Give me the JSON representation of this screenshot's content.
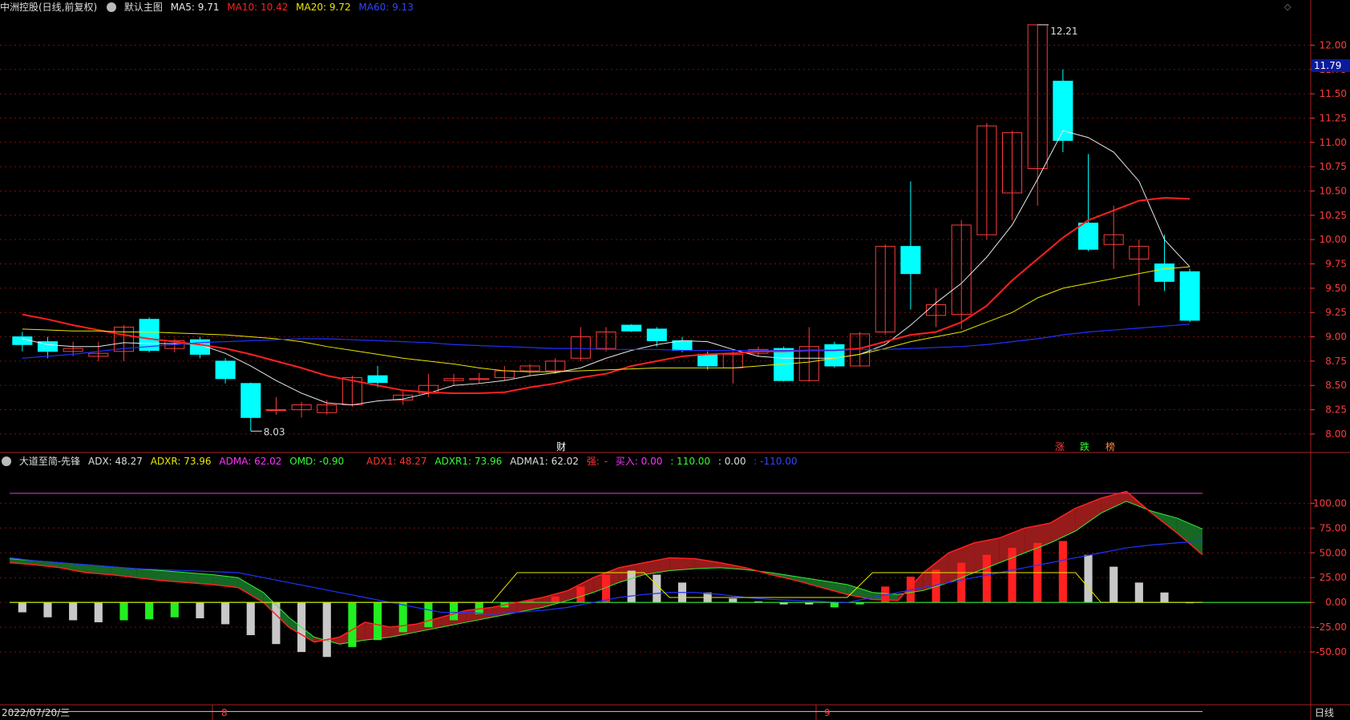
{
  "colors": {
    "background": "#000000",
    "up": "#ff3c3c",
    "down": "#00ffff",
    "ma5": "#e8e8e8",
    "ma10": "#ff2020",
    "ma20": "#e8e800",
    "ma60": "#2030ff",
    "grid": "#7a1010",
    "axis_text": "#ff3c3c",
    "purple": "#cc33cc",
    "green_band": "#1a7a2a",
    "red_band": "#b02020"
  },
  "main_header": {
    "stock": "中洲控股(日线,前复权)",
    "template": "默认主图",
    "ma5": "MA5: 9.71",
    "ma10": "MA10: 10.42",
    "ma20": "MA20: 9.72",
    "ma60": "MA60: 9.13"
  },
  "sub_header": {
    "name": "大道至简-先锋",
    "adx": "ADX: 48.27",
    "adxr": "ADXR: 73.96",
    "adma": "ADMA: 62.02",
    "omd": "OMD: -0.90",
    "adx1": "ADX1: 48.27",
    "adxr1": "ADXR1: 73.96",
    "adma1": "ADMA1: 62.02",
    "strong_label": "强:",
    "strong_val": "-",
    "buy": "买入: 0.00",
    "v110": ": 110.00",
    "v0": ": 0.00",
    "vneg110": ": -110.00"
  },
  "annotations": {
    "high": "12.21",
    "low": "8.03",
    "last_price": "11.79",
    "cai": "财",
    "zhang": "涨",
    "die": "跌",
    "bang": "榜"
  },
  "bottom_bar": {
    "start_date": "2022/07/20/三",
    "m8": "8",
    "m9": "9",
    "period": "日线"
  },
  "chart_data": [
    {
      "type": "candlestick",
      "title": "中洲控股(日线,前复权)",
      "ylim": [
        7.95,
        12.3
      ],
      "yticks": [
        8.0,
        8.25,
        8.5,
        8.75,
        9.0,
        9.25,
        9.5,
        9.75,
        10.0,
        10.25,
        10.5,
        10.75,
        11.0,
        11.25,
        11.5,
        11.75,
        12.0
      ],
      "candles": [
        [
          9.0,
          8.92,
          9.05,
          8.85
        ],
        [
          8.95,
          8.85,
          9.0,
          8.78
        ],
        [
          8.85,
          8.88,
          8.95,
          8.8
        ],
        [
          8.8,
          8.83,
          8.95,
          8.75
        ],
        [
          8.85,
          9.1,
          9.12,
          8.75
        ],
        [
          9.18,
          8.86,
          9.2,
          8.84
        ],
        [
          8.88,
          8.96,
          8.98,
          8.84
        ],
        [
          8.97,
          8.82,
          9.0,
          8.78
        ],
        [
          8.75,
          8.57,
          8.78,
          8.52
        ],
        [
          8.52,
          8.17,
          8.53,
          8.03
        ],
        [
          8.25,
          8.25,
          8.38,
          8.2
        ],
        [
          8.25,
          8.3,
          8.33,
          8.17
        ],
        [
          8.22,
          8.3,
          8.35,
          8.2
        ],
        [
          8.3,
          8.58,
          8.6,
          8.28
        ],
        [
          8.6,
          8.53,
          8.7,
          8.48
        ],
        [
          8.35,
          8.4,
          8.45,
          8.3
        ],
        [
          8.42,
          8.5,
          8.62,
          8.38
        ],
        [
          8.55,
          8.57,
          8.62,
          8.5
        ],
        [
          8.56,
          8.57,
          8.63,
          8.52
        ],
        [
          8.58,
          8.65,
          8.7,
          8.55
        ],
        [
          8.65,
          8.7,
          8.72,
          8.6
        ],
        [
          8.65,
          8.75,
          8.78,
          8.62
        ],
        [
          8.78,
          9.0,
          9.1,
          8.75
        ],
        [
          8.88,
          9.05,
          9.1,
          8.85
        ],
        [
          9.12,
          9.06,
          9.13,
          9.05
        ],
        [
          9.08,
          8.96,
          9.1,
          8.9
        ],
        [
          8.96,
          8.86,
          9.0,
          8.84
        ],
        [
          8.82,
          8.7,
          8.85,
          8.66
        ],
        [
          8.68,
          8.82,
          8.85,
          8.52
        ],
        [
          8.83,
          8.87,
          8.9,
          8.8
        ],
        [
          8.88,
          8.55,
          8.9,
          8.54
        ],
        [
          8.55,
          8.9,
          9.1,
          8.54
        ],
        [
          8.92,
          8.7,
          8.95,
          8.68
        ],
        [
          8.7,
          9.03,
          9.05,
          8.7
        ],
        [
          9.05,
          9.93,
          9.95,
          9.02
        ],
        [
          9.93,
          9.65,
          10.6,
          9.28
        ],
        [
          9.22,
          9.33,
          9.5,
          9.1
        ],
        [
          9.23,
          10.15,
          10.2,
          9.08
        ],
        [
          10.05,
          11.17,
          11.2,
          10.0
        ],
        [
          10.48,
          11.1,
          11.12,
          10.2
        ],
        [
          10.73,
          12.21,
          12.21,
          10.35
        ],
        [
          11.63,
          11.02,
          11.75,
          10.9
        ],
        [
          10.17,
          9.9,
          10.88,
          9.88
        ],
        [
          9.95,
          10.05,
          10.35,
          9.7
        ],
        [
          9.8,
          9.93,
          10.0,
          9.32
        ],
        [
          9.75,
          9.57,
          10.05,
          9.47
        ],
        [
          9.67,
          9.17,
          9.7,
          9.15
        ]
      ],
      "series": [
        {
          "name": "MA5",
          "values": [
            8.98,
            8.92,
            8.9,
            8.9,
            8.94,
            8.93,
            8.93,
            8.92,
            8.83,
            8.7,
            8.55,
            8.42,
            8.32,
            8.3,
            8.34,
            8.36,
            8.42,
            8.5,
            8.52,
            8.55,
            8.6,
            8.63,
            8.68,
            8.78,
            8.86,
            8.92,
            8.96,
            8.95,
            8.87,
            8.8,
            8.78,
            8.78,
            8.78,
            8.82,
            8.92,
            9.12,
            9.35,
            9.55,
            9.82,
            10.15,
            10.62,
            11.12,
            11.05,
            10.9,
            10.6,
            10.0,
            9.72
          ]
        },
        {
          "name": "MA10",
          "values": [
            9.23,
            9.18,
            9.12,
            9.07,
            9.02,
            8.98,
            8.95,
            8.92,
            8.88,
            8.82,
            8.75,
            8.68,
            8.6,
            8.55,
            8.5,
            8.45,
            8.43,
            8.42,
            8.42,
            8.43,
            8.48,
            8.52,
            8.58,
            8.62,
            8.7,
            8.75,
            8.8,
            8.82,
            8.83,
            8.85,
            8.85,
            8.86,
            8.86,
            8.88,
            8.95,
            9.02,
            9.05,
            9.15,
            9.32,
            9.58,
            9.8,
            10.02,
            10.2,
            10.3,
            10.4,
            10.43,
            10.42
          ]
        },
        {
          "name": "MA20",
          "values": [
            9.08,
            9.07,
            9.06,
            9.06,
            9.05,
            9.05,
            9.04,
            9.03,
            9.02,
            9.0,
            8.98,
            8.95,
            8.9,
            8.86,
            8.82,
            8.78,
            8.75,
            8.72,
            8.68,
            8.65,
            8.64,
            8.64,
            8.65,
            8.66,
            8.67,
            8.68,
            8.68,
            8.68,
            8.68,
            8.7,
            8.72,
            8.74,
            8.78,
            8.82,
            8.88,
            8.95,
            9.0,
            9.05,
            9.15,
            9.25,
            9.4,
            9.5,
            9.55,
            9.6,
            9.65,
            9.7,
            9.72
          ]
        },
        {
          "name": "MA60",
          "values": [
            8.78,
            8.8,
            8.82,
            8.85,
            8.88,
            8.9,
            8.92,
            8.94,
            8.95,
            8.96,
            8.97,
            8.98,
            8.98,
            8.97,
            8.96,
            8.95,
            8.94,
            8.92,
            8.91,
            8.9,
            8.89,
            8.88,
            8.88,
            8.87,
            8.87,
            8.87,
            8.86,
            8.86,
            8.86,
            8.86,
            8.86,
            8.86,
            8.86,
            8.87,
            8.87,
            8.88,
            8.89,
            8.9,
            8.92,
            8.95,
            8.98,
            9.02,
            9.05,
            9.07,
            9.09,
            9.11,
            9.13
          ]
        }
      ]
    },
    {
      "type": "indicator",
      "title": "大道至简-先锋",
      "ylim": [
        -100,
        135
      ],
      "yticks": [
        100.0,
        75.0,
        50.0,
        25.0,
        0.0,
        -25.0,
        -50.0
      ],
      "hlines": [
        110,
        0,
        -110
      ],
      "bars": [
        -10,
        -15,
        -18,
        -20,
        -18,
        -17,
        -15,
        -16,
        -22,
        -33,
        -42,
        -50,
        -55,
        -45,
        -38,
        -30,
        -25,
        -18,
        -12,
        -5,
        2,
        6,
        16,
        28,
        32,
        28,
        20,
        10,
        4,
        1,
        -2,
        -2,
        -5,
        -2,
        16,
        26,
        33,
        40,
        48,
        55,
        60,
        62,
        48,
        36,
        20,
        10,
        0
      ],
      "bar_colors": [
        "gray",
        "gray",
        "gray",
        "gray",
        "green",
        "green",
        "green",
        "gray",
        "gray",
        "gray",
        "gray",
        "gray",
        "gray",
        "green",
        "green",
        "green",
        "green",
        "green",
        "green",
        "green",
        "red",
        "red",
        "red",
        "red",
        "gray",
        "gray",
        "gray",
        "gray",
        "gray",
        "gray",
        "gray",
        "gray",
        "green",
        "green",
        "red",
        "red",
        "red",
        "red",
        "red",
        "red",
        "red",
        "red",
        "gray",
        "gray",
        "gray",
        "gray",
        "gray"
      ],
      "series": [
        {
          "name": "ADX",
          "values": [
            40,
            38,
            35,
            30,
            28,
            25,
            22,
            20,
            18,
            15,
            0,
            -25,
            -40,
            -35,
            -20,
            -25,
            -22,
            -15,
            -8,
            -5,
            0,
            5,
            12,
            25,
            35,
            40,
            45,
            44,
            40,
            35,
            28,
            22,
            15,
            8,
            3,
            2,
            30,
            50,
            60,
            65,
            75,
            80,
            95,
            105,
            112,
            90,
            70,
            48
          ]
        },
        {
          "name": "ADXR",
          "values": [
            44,
            42,
            40,
            38,
            36,
            34,
            32,
            30,
            28,
            25,
            10,
            -15,
            -35,
            -42,
            -38,
            -35,
            -30,
            -25,
            -20,
            -15,
            -10,
            -5,
            2,
            10,
            20,
            28,
            32,
            34,
            35,
            33,
            30,
            26,
            22,
            18,
            10,
            8,
            12,
            20,
            30,
            40,
            50,
            60,
            72,
            90,
            102,
            92,
            85,
            74
          ]
        },
        {
          "name": "ADMA",
          "values": [
            45,
            42,
            40,
            38,
            36,
            34,
            33,
            32,
            31,
            30,
            25,
            20,
            15,
            10,
            5,
            0,
            -5,
            -10,
            -10,
            -12,
            -10,
            -8,
            -5,
            0,
            5,
            8,
            10,
            10,
            8,
            5,
            3,
            2,
            1,
            0,
            5,
            10,
            15,
            20,
            25,
            30,
            35,
            40,
            45,
            50,
            55,
            58,
            60,
            62
          ]
        },
        {
          "name": "OMD",
          "values": [
            0,
            0,
            0,
            0,
            0,
            0,
            0,
            0,
            0,
            0,
            0,
            0,
            0,
            0,
            0,
            0,
            0,
            0,
            0,
            0,
            30,
            30,
            30,
            30,
            30,
            30,
            5,
            5,
            5,
            5,
            5,
            5,
            5,
            5,
            30,
            30,
            30,
            30,
            30,
            30,
            30,
            30,
            30,
            0,
            0,
            0,
            0,
            0
          ]
        }
      ]
    }
  ]
}
